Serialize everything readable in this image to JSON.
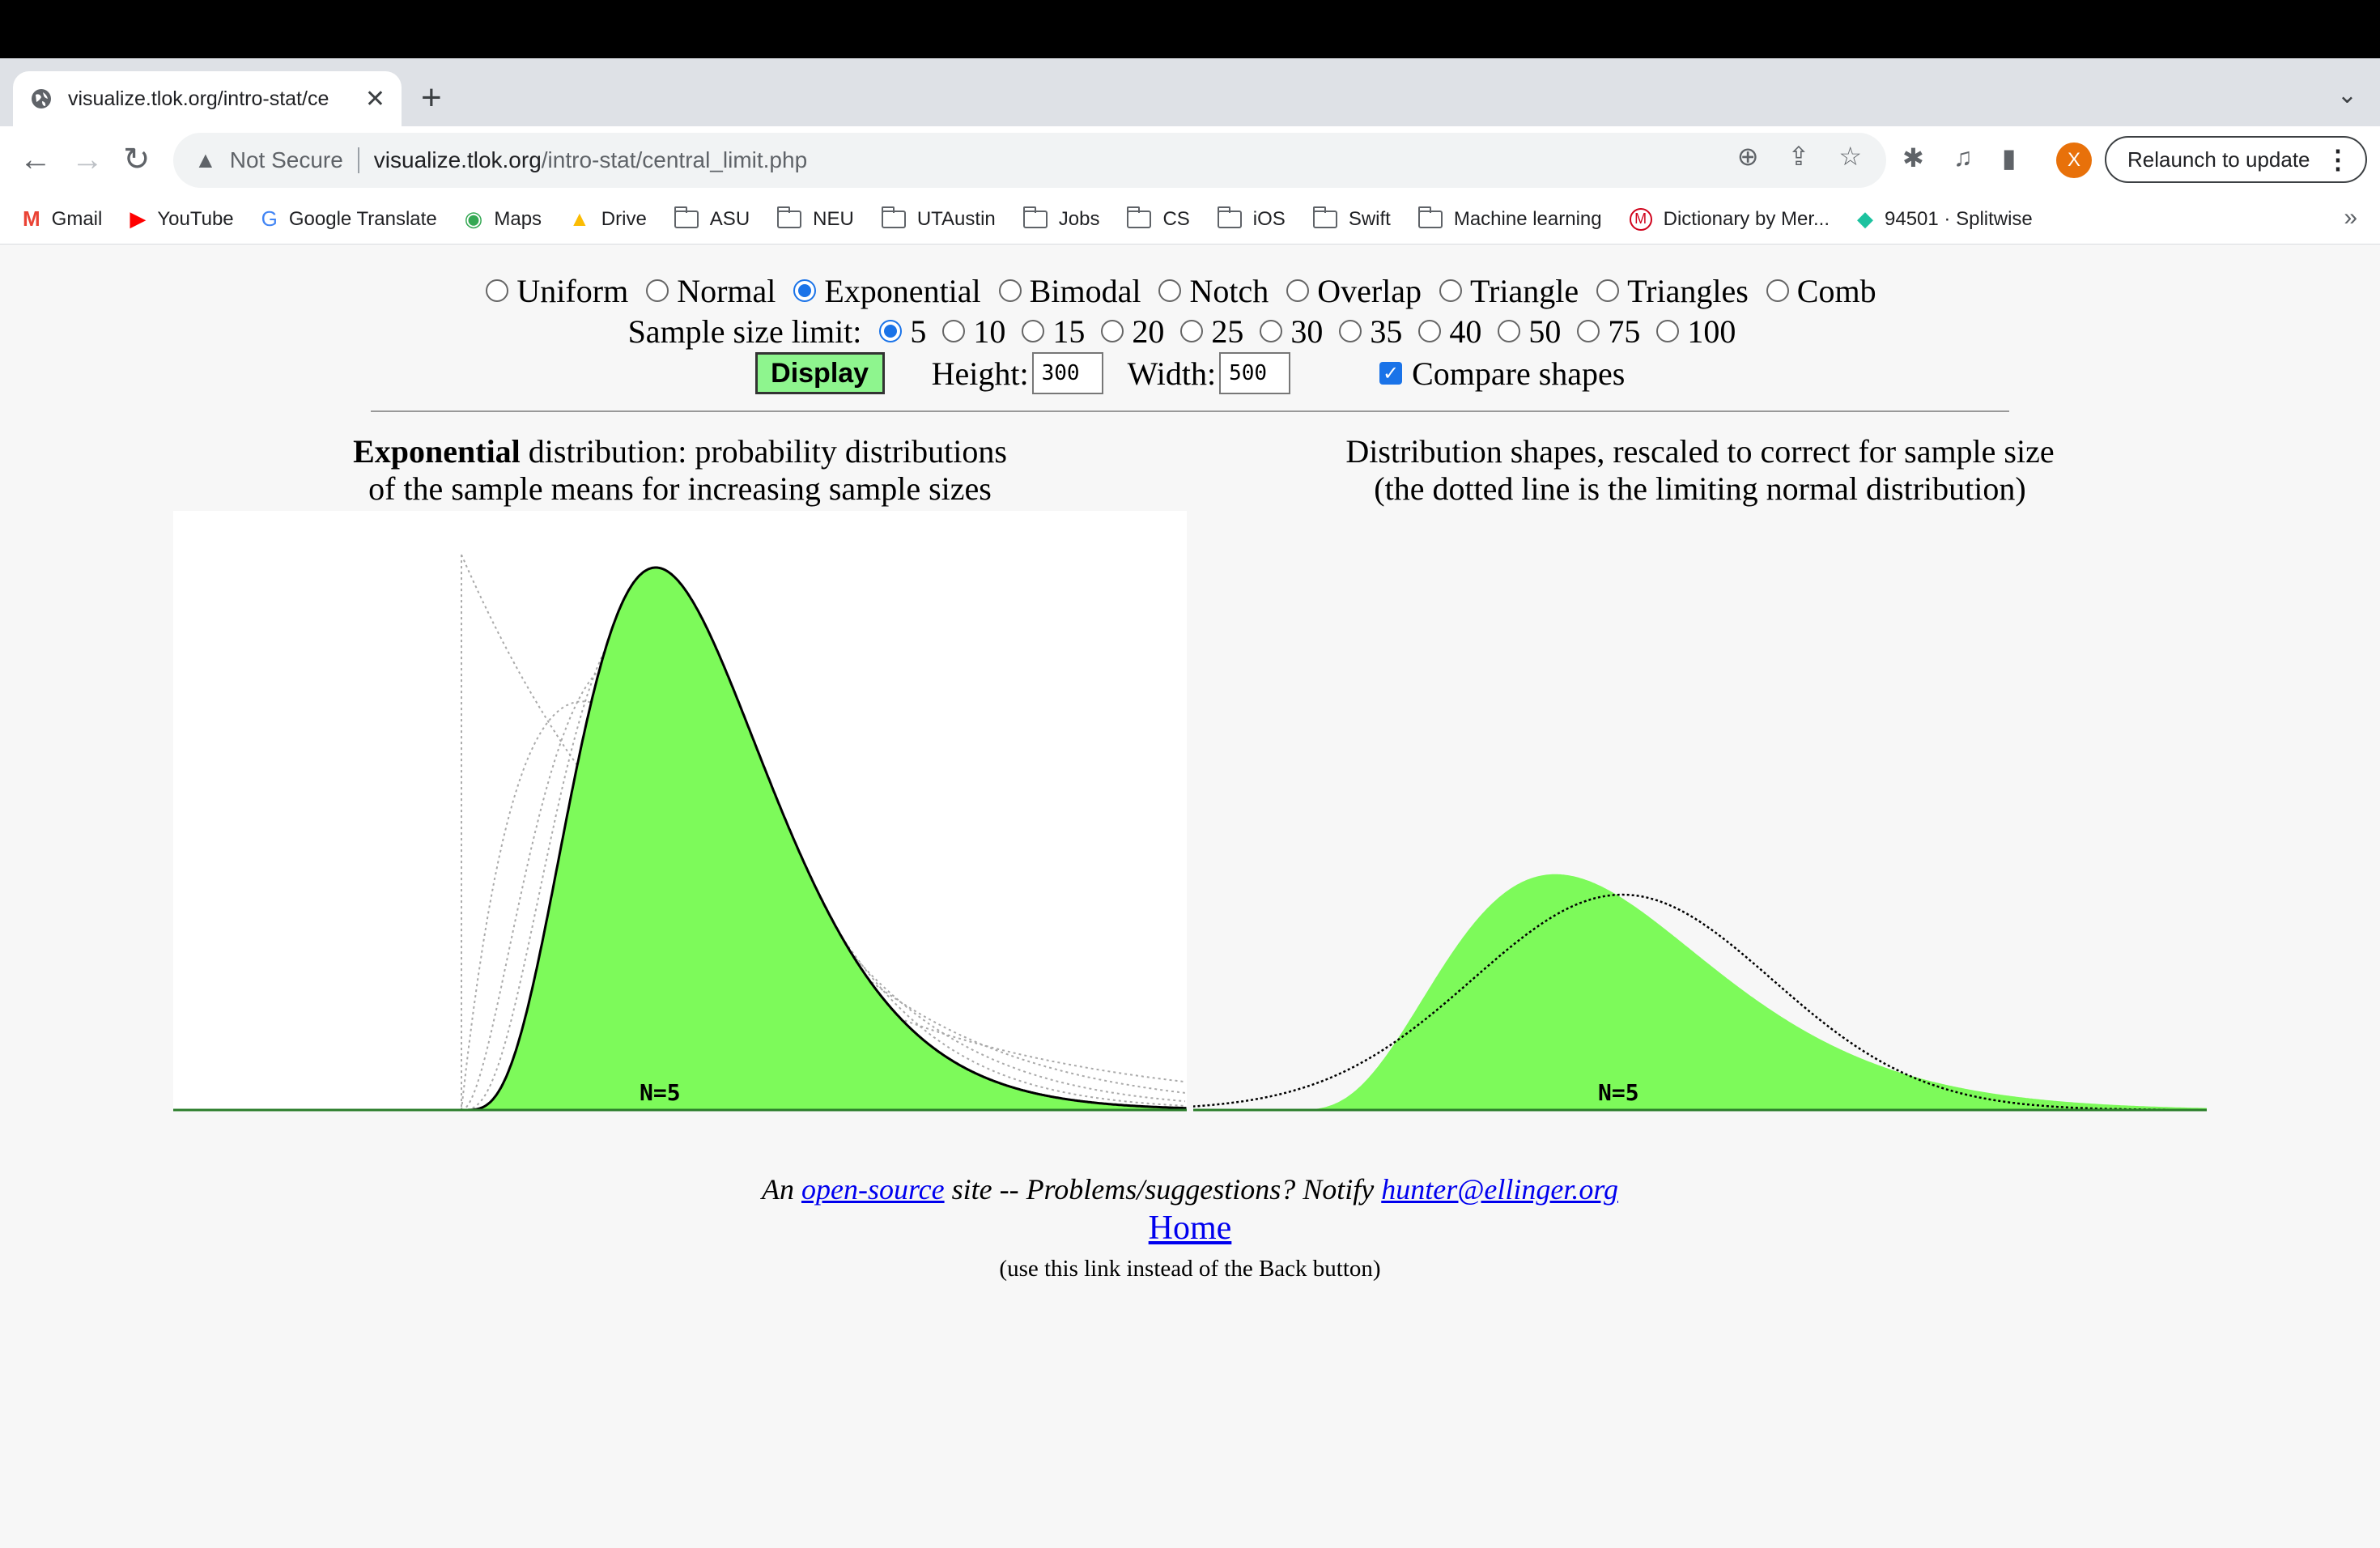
{
  "browser": {
    "tab_title": "visualize.tlok.org/intro-stat/ce",
    "url_security": "Not Secure",
    "url_host": "visualize.tlok.org",
    "url_path": "/intro-stat/central_limit.php",
    "relaunch_label": "Relaunch to update",
    "avatar_initial": "X",
    "bookmarks": [
      "Gmail",
      "YouTube",
      "Google Translate",
      "Maps",
      "Drive",
      "ASU",
      "NEU",
      "UTAustin",
      "Jobs",
      "CS",
      "iOS",
      "Swift",
      "Machine learning",
      "Dictionary by Mer...",
      "94501 · Splitwise"
    ]
  },
  "controls": {
    "distributions": [
      "Uniform",
      "Normal",
      "Exponential",
      "Bimodal",
      "Notch",
      "Overlap",
      "Triangle",
      "Triangles",
      "Comb"
    ],
    "selected_distribution": "Exponential",
    "sample_size_label": "Sample size limit:",
    "sample_sizes": [
      "5",
      "10",
      "15",
      "20",
      "25",
      "30",
      "35",
      "40",
      "50",
      "75",
      "100"
    ],
    "selected_sample_size": "5",
    "display_label": "Display",
    "height_label": "Height:",
    "height_value": "300",
    "width_label": "Width:",
    "width_value": "500",
    "compare_label": "Compare shapes",
    "compare_checked": true
  },
  "left_caption": {
    "bold": "Exponential",
    "line1": " distribution: probability distributions",
    "line2": "of the sample means for increasing sample sizes"
  },
  "right_caption": {
    "line1": "Distribution shapes, rescaled to correct for sample size",
    "line2": "(the dotted line is the limiting normal distribution)"
  },
  "chart_data": [
    {
      "type": "area",
      "label": "N=5",
      "description": "Sampling distribution of the mean of N=5 exponential samples (filled green), with dotted curves for N=1..4",
      "fill_color": "#7dfa5a"
    },
    {
      "type": "area",
      "label": "N=5",
      "description": "Rescaled shape for N=5 compared to limiting normal (dotted)",
      "fill_color": "#7dfa5a"
    }
  ],
  "footer": {
    "prefix": "An ",
    "link1": "open-source",
    "middle": " site  --  Problems/suggestions?  Notify ",
    "email": "hunter@ellinger.org",
    "home": "Home",
    "note": "(use this link instead of the Back button)"
  }
}
